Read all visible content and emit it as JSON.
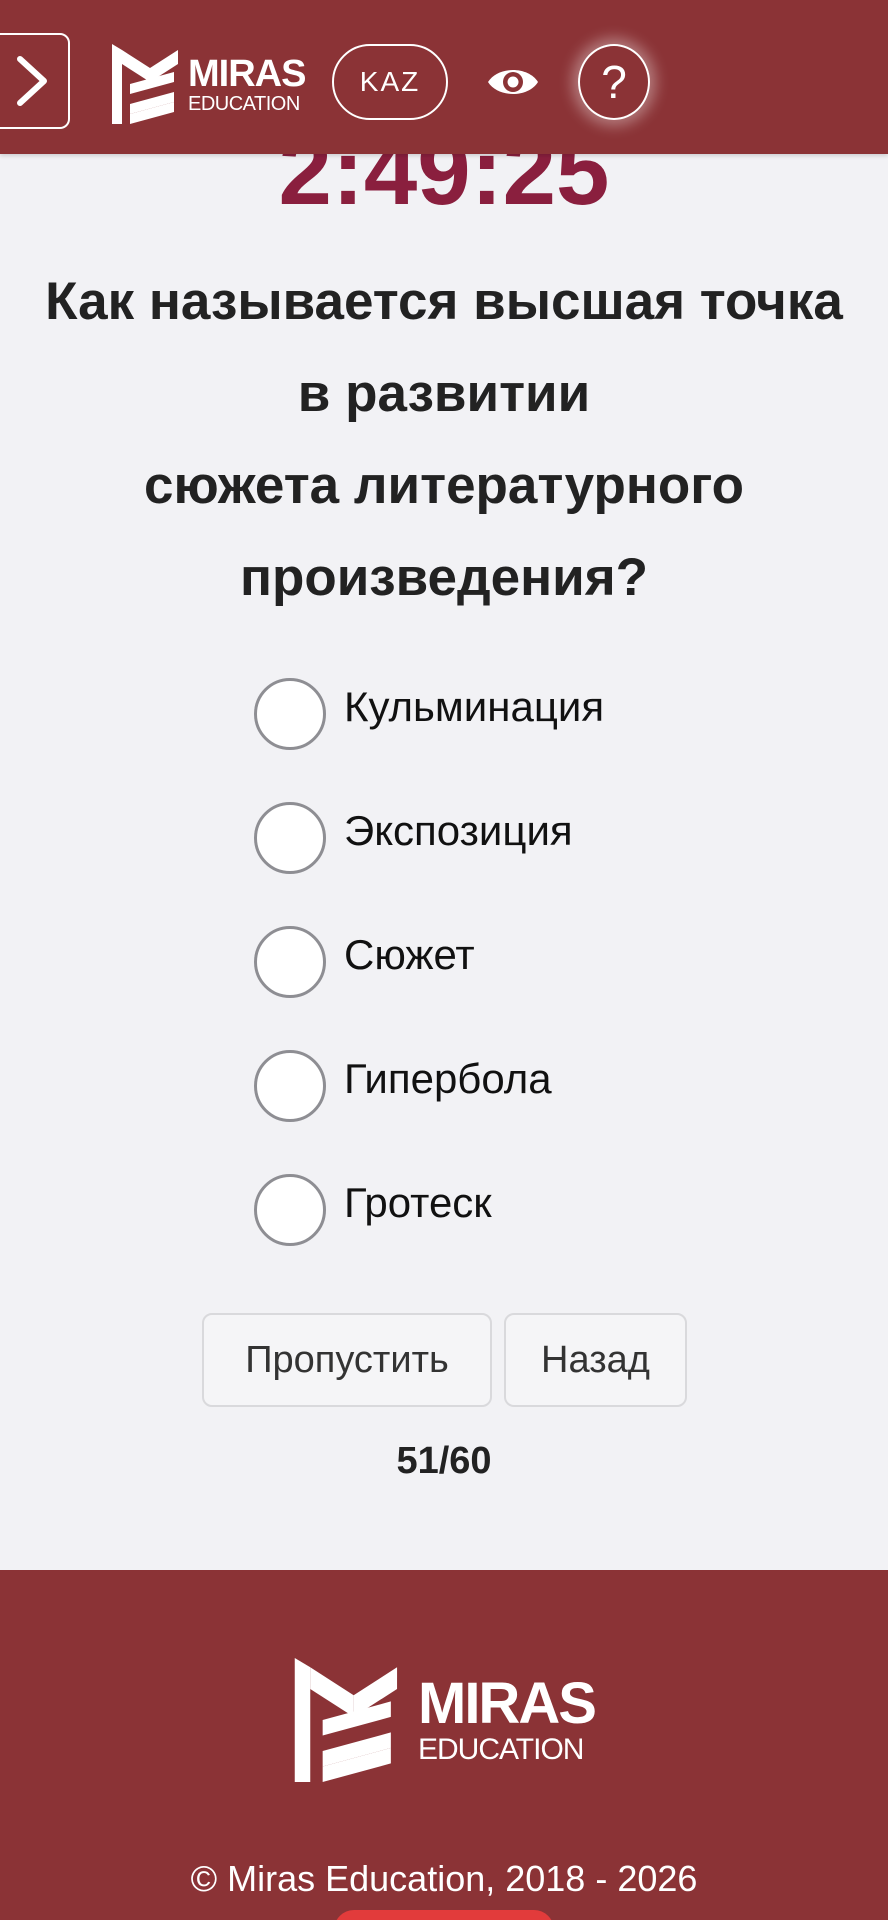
{
  "header": {
    "brand_word1": "MIRAS",
    "brand_word2": "EDUCATION",
    "language": "KAZ",
    "help_symbol": "?",
    "icons": [
      "chevron-right-icon",
      "eye-icon",
      "question-icon"
    ]
  },
  "quiz": {
    "timer": "2:49:25",
    "question_lines": [
      "Как называется высшая точка",
      "в развитии",
      "сюжета литературного",
      "произведения?"
    ],
    "options": [
      {
        "label": "Кульминация",
        "selected": false
      },
      {
        "label": "Экспозиция",
        "selected": false
      },
      {
        "label": "Сюжет",
        "selected": false
      },
      {
        "label": "Гипербола",
        "selected": false
      },
      {
        "label": "Гротеск",
        "selected": false
      }
    ],
    "skip_label": "Пропустить",
    "back_label": "Назад",
    "progress": "51/60"
  },
  "footer": {
    "brand_word1": "MIRAS",
    "brand_word2": "EDUCATION",
    "copyright": "© Miras Education, 2018 - 2026"
  },
  "colors": {
    "primary": "#8b3336",
    "timer": "#8a1f3e",
    "background": "#f2f2f5"
  }
}
